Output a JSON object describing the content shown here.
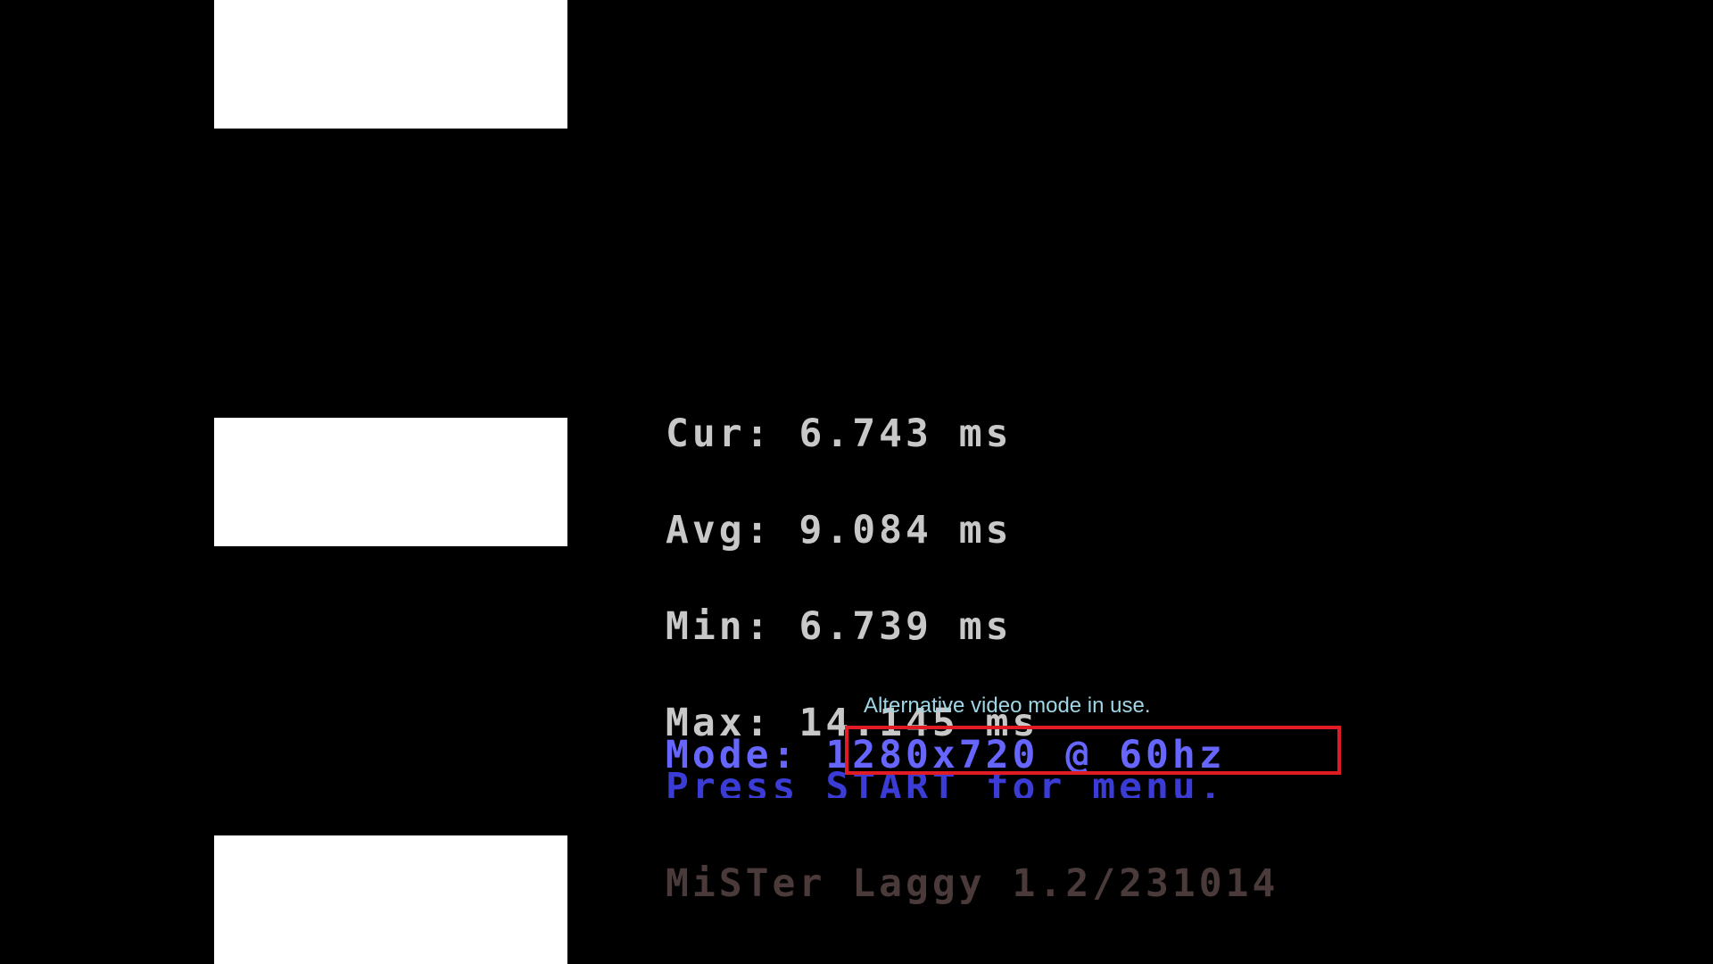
{
  "stats": {
    "cur": "Cur: 6.743 ms",
    "avg": "Avg: 9.084 ms",
    "min": "Min: 6.739 ms",
    "max": "Max: 14.145 ms"
  },
  "notice": "Alternative video mode in use.",
  "mode": {
    "label": "Mode: ",
    "value": "1280x720 @ 60hz"
  },
  "prompt": "Press START for menu.",
  "version": "MiSTer Laggy 1.2/231014",
  "colors": {
    "background": "#000000",
    "flash_box": "#ffffff",
    "stats_text": "#c8c8c8",
    "mode_text": "#6666ff",
    "prompt_text": "#3b3bd6",
    "version_text": "#4a3a3a",
    "notice_text": "#9fd6e6",
    "highlight": "#e01b24"
  }
}
